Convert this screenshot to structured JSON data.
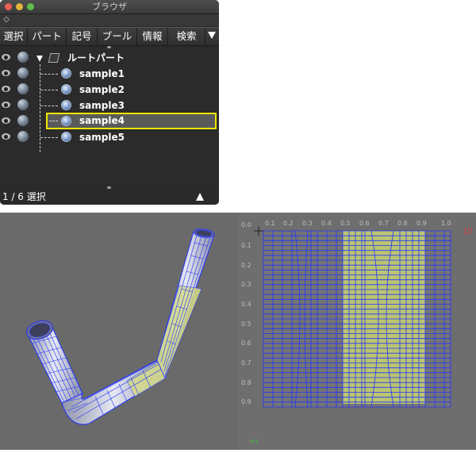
{
  "window": {
    "title": "ブラウザ"
  },
  "menubar": {
    "items": [
      "選択",
      "パート",
      "記号",
      "ブール",
      "情報",
      "検索"
    ]
  },
  "outliner": {
    "root": "ルートパート",
    "children": [
      "sample1",
      "sample2",
      "sample3",
      "sample4",
      "sample5"
    ],
    "selected": "sample4"
  },
  "status": {
    "text": "1 / 6 選択"
  },
  "uv_editor": {
    "u_ticks": [
      "0.0",
      "0.1",
      "0.2",
      "0.3",
      "0.4",
      "0.5",
      "0.6",
      "0.7",
      "0.8",
      "0.9",
      "1.0"
    ],
    "v_ticks": [
      "0.1",
      "0.2",
      "0.3",
      "0.4",
      "0.5",
      "0.6",
      "0.7",
      "0.8",
      "0.9"
    ],
    "u_axis_label": "+U",
    "v_axis_label": "+V"
  },
  "colors": {
    "selection_outline": "#f0e600",
    "wireframe": "#2233ff",
    "uv_fill": "#c8d470",
    "u_axis": "#e04040",
    "v_axis": "#40c040"
  }
}
